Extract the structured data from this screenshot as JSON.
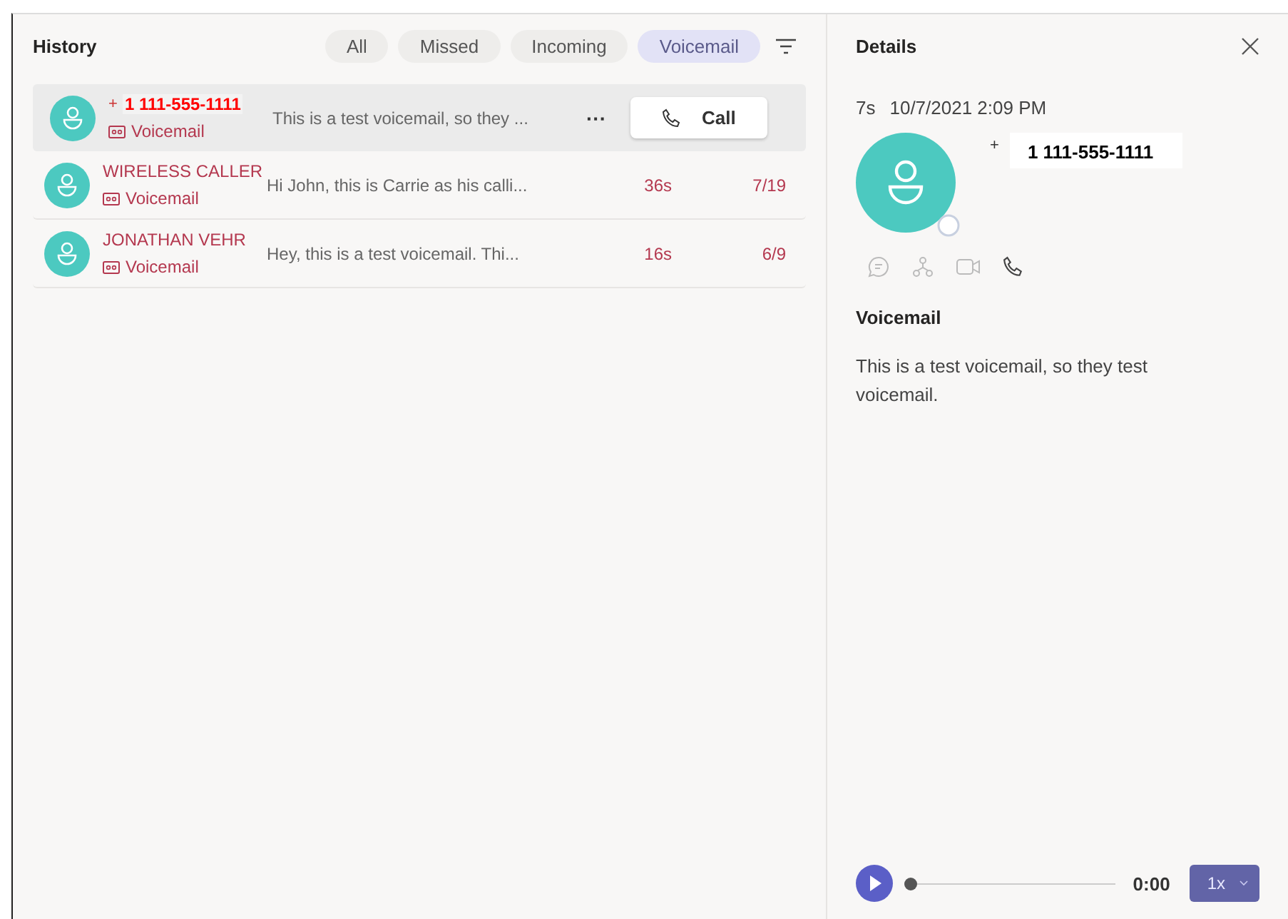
{
  "history": {
    "title": "History",
    "filters": [
      {
        "label": "All",
        "selected": false
      },
      {
        "label": "Missed",
        "selected": false
      },
      {
        "label": "Incoming",
        "selected": false
      },
      {
        "label": "Voicemail",
        "selected": true
      }
    ],
    "rows": [
      {
        "prefix": "+",
        "name": "1 111-555-1111",
        "kind_label": "Voicemail",
        "preview": "This is a test voicemail, so they ...",
        "selected": true,
        "more": "···",
        "call_label": "Call"
      },
      {
        "name": "WIRELESS CALLER",
        "kind_label": "Voicemail",
        "preview": "Hi John, this is Carrie as his calli...",
        "duration": "36s",
        "date": "7/19",
        "selected": false
      },
      {
        "name": "JONATHAN VEHR",
        "kind_label": "Voicemail",
        "preview": "Hey, this is a test voicemail. Thi...",
        "duration": "16s",
        "date": "6/9",
        "selected": false
      }
    ]
  },
  "details": {
    "title": "Details",
    "duration": "7s",
    "datetime": "10/7/2021 2:09 PM",
    "prefix": "+",
    "number": "1 111-555-1111",
    "section": "Voicemail",
    "transcript": "This is a test voicemail, so they test voicemail.",
    "player": {
      "level": 0,
      "time": "0:00",
      "speed": "1x"
    }
  }
}
